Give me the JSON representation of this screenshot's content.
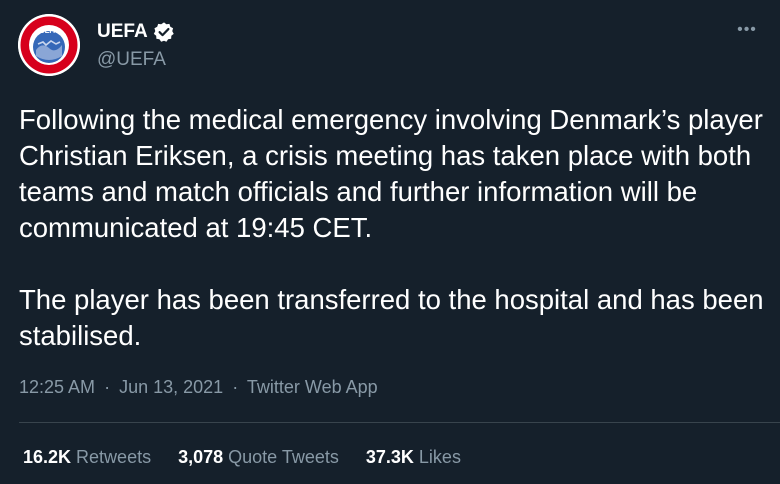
{
  "author": {
    "name": "UEFA",
    "handle": "@UEFA",
    "verified": true,
    "avatar_icon": "uefa-logo",
    "avatar_text": "UEFA"
  },
  "more_icon": "more-horizontal-icon",
  "more_glyph": "•••",
  "tweet": {
    "paragraphs": [
      "Following the medical emergency involving Denmark’s player Christian Eriksen, a crisis meeting has taken place with both teams and match officials and further information will be communicated at 19:45 CET.",
      "The player has been transferred to the hospital and has been stabilised."
    ],
    "time": "12:25 AM",
    "date": "Jun 13, 2021",
    "source": "Twitter Web App",
    "separator": "·"
  },
  "stats": {
    "retweets_count": "16.2K",
    "retweets_label": "Retweets",
    "quotes_count": "3,078",
    "quotes_label": "Quote Tweets",
    "likes_count": "37.3K",
    "likes_label": "Likes"
  },
  "colors": {
    "background": "#15202b",
    "text": "#ffffff",
    "secondary": "#8899a6",
    "divider": "#38444d",
    "avatar_red": "#d7001c",
    "avatar_blue": "#3568b8"
  }
}
